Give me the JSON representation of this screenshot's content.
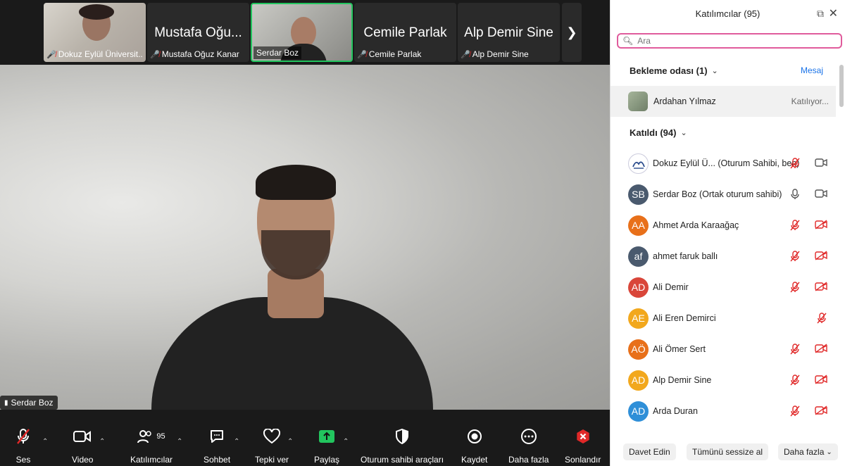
{
  "strip": {
    "tiles": [
      {
        "label": "Dokuz Eylül Üniversit...",
        "bigname": ""
      },
      {
        "label": "Mustafa Oğuz Kanar",
        "bigname": "Mustafa Oğu..."
      },
      {
        "label": "Serdar Boz",
        "bigname": ""
      },
      {
        "label": "Cemile Parlak",
        "bigname": "Cemile Parlak"
      },
      {
        "label": "Alp Demir Sine",
        "bigname": "Alp Demir Sine"
      }
    ],
    "next_icon": "chevron-right-icon"
  },
  "main": {
    "speaker_label": "Serdar Boz"
  },
  "toolbar": {
    "audio": "Ses",
    "video": "Video",
    "participants": "Katılımcılar",
    "participants_count": "95",
    "chat": "Sohbet",
    "react": "Tepki ver",
    "share": "Paylaş",
    "host_tools": "Oturum sahibi araçları",
    "record": "Kaydet",
    "more": "Daha fazla",
    "end": "Sonlandır"
  },
  "panel": {
    "title": "Katılımcılar (95)",
    "search_placeholder": "Ara",
    "waiting_header": "Bekleme odası (1)",
    "message_link": "Mesaj",
    "waiting": {
      "name": "Ardahan Yılmaz",
      "status": "Katılıyor..."
    },
    "joined_header": "Katıldı (94)",
    "participants": [
      {
        "initials": "",
        "name": "Dokuz Eylül Ü... (Oturum Sahibi, ben)",
        "color": "#ffffff",
        "mic": "muted",
        "cam": "on"
      },
      {
        "initials": "SB",
        "name": "Serdar Boz (Ortak oturum sahibi)",
        "color": "#4a5a6e",
        "mic": "on",
        "cam": "on"
      },
      {
        "initials": "AA",
        "name": "Ahmet Arda Karaağaç",
        "color": "#e8701a",
        "mic": "muted",
        "cam": "off"
      },
      {
        "initials": "af",
        "name": "ahmet faruk ballı",
        "color": "#4a5a6e",
        "mic": "muted",
        "cam": "off"
      },
      {
        "initials": "AD",
        "name": "Ali Demir",
        "color": "#d9463a",
        "mic": "muted",
        "cam": "off"
      },
      {
        "initials": "AE",
        "name": "Ali Eren Demirci",
        "color": "#f2a81d",
        "mic": "muted",
        "cam": "none"
      },
      {
        "initials": "AÖ",
        "name": "Ali Ömer Sert",
        "color": "#e8701a",
        "mic": "muted",
        "cam": "off"
      },
      {
        "initials": "AD",
        "name": "Alp Demir Sine",
        "color": "#f2a81d",
        "mic": "muted",
        "cam": "off"
      },
      {
        "initials": "AD",
        "name": "Arda Duran",
        "color": "#2f8fd8",
        "mic": "muted",
        "cam": "off"
      }
    ],
    "footer": {
      "invite": "Davet Edin",
      "mute_all": "Tümünü sessize al",
      "more": "Daha fazla"
    }
  }
}
